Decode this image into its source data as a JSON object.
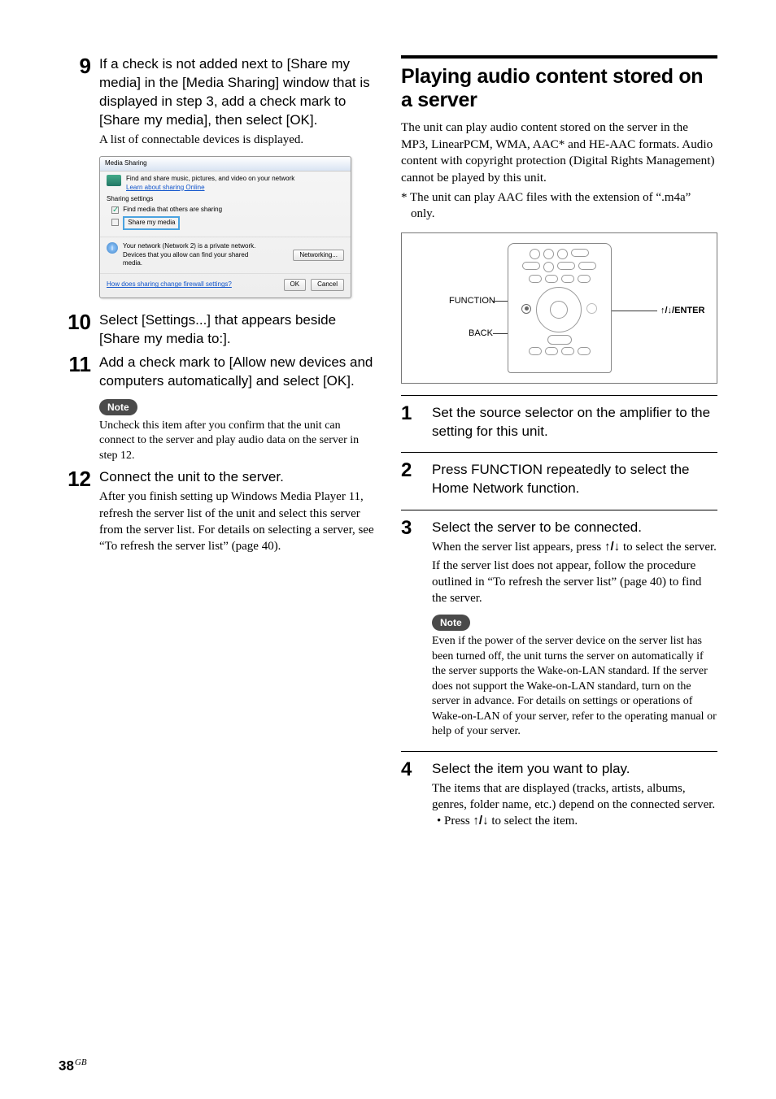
{
  "page_number": "38",
  "page_cc": "GB",
  "left": {
    "step9": {
      "num": "9",
      "lead": "If a check is not added next to [Share my media] in the [Media Sharing] window that is displayed in step 3, add a check mark to [Share my media], then select [OK].",
      "sub": "A list of connectable devices is displayed."
    },
    "dialog": {
      "title": "Media Sharing",
      "desc": "Find and share music, pictures, and video on your network",
      "learn": "Learn about sharing Online",
      "section_label": "Sharing settings",
      "find_chk_label": "Find media that others are sharing",
      "share_btn": "Share my media",
      "net_msg": "Your network (Network 2) is a private network. Devices that you allow can find your shared media.",
      "networking": "Networking...",
      "firewall": "How does sharing change firewall settings?",
      "ok": "OK",
      "cancel": "Cancel"
    },
    "step10": {
      "num": "10",
      "lead": "Select [Settings...] that appears beside [Share my media to:]."
    },
    "step11": {
      "num": "11",
      "lead": "Add a check mark to [Allow new devices and computers automatically] and select [OK].",
      "note_label": "Note",
      "note_text": "Uncheck this item after you confirm that the unit can connect to the server and play audio data on the server in step 12."
    },
    "step12": {
      "num": "12",
      "lead": "Connect the unit to the server.",
      "sub": "After you finish setting up Windows Media Player 11, refresh the server list of the unit and select this server from the server list. For details on selecting a server, see “To refresh the server list” (page 40)."
    }
  },
  "right": {
    "heading": "Playing audio content stored on a server",
    "intro": "The unit can play audio content stored on the server in the MP3, LinearPCM, WMA, AAC* and HE-AAC formats. Audio content with copyright protection (Digital Rights Management) cannot be played by this unit.",
    "footnote": "* The unit can play AAC files with the extension of “.m4a” only.",
    "diagram": {
      "function": "FUNCTION",
      "back": "BACK",
      "enter": "↑/↓/ENTER"
    },
    "s1": {
      "num": "1",
      "lead": "Set the source selector on the amplifier to the setting for this unit."
    },
    "s2": {
      "num": "2",
      "lead": "Press FUNCTION repeatedly to select the Home Network function."
    },
    "s3": {
      "num": "3",
      "lead": "Select the server to be connected.",
      "sub1a": "When the server list appears, press ",
      "sub1b": " to select the server.",
      "sub2": "If the server list does not appear, follow the procedure outlined in “To refresh the server list” (page 40) to find the server.",
      "note_label": "Note",
      "note_text": "Even if the power of the server device on the server list has been turned off, the unit turns the server on automatically if the server supports the Wake-on-LAN standard. If the server does not support the Wake-on-LAN standard, turn on the server in advance. For details on settings or operations of Wake-on-LAN of your server, refer to the operating manual or help of your server."
    },
    "s4": {
      "num": "4",
      "lead": "Select the item you want to play.",
      "sub": "The items that are displayed (tracks, artists, albums, genres, folder name, etc.) depend on the connected server.",
      "bul_a": "• Press ",
      "bul_b": " to select the item."
    },
    "arrows": "↑/↓"
  }
}
